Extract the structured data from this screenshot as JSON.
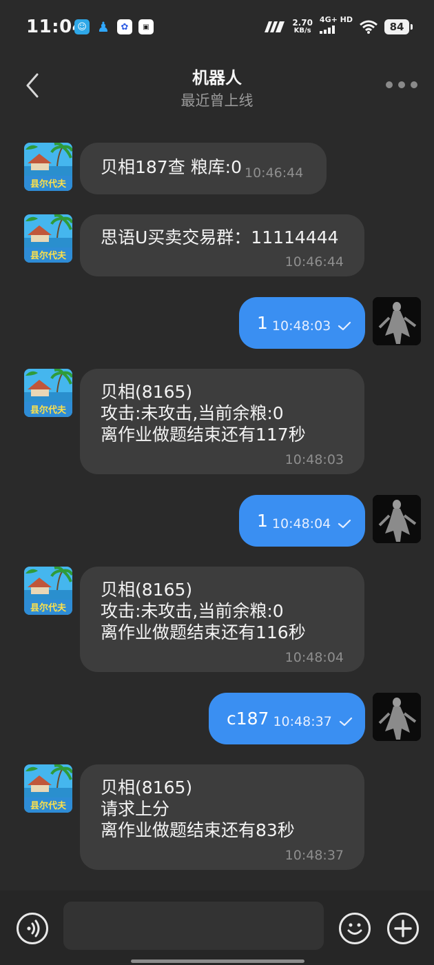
{
  "status_bar": {
    "time": "11:04",
    "net_speed_value": "2.70",
    "net_speed_unit": "KB/s",
    "network_label": "4G+ HD",
    "battery": "84",
    "icons": [
      "chat-app-icon",
      "qq-icon",
      "baidu-icon",
      "notification-badge-icon",
      "signal-strength-icon",
      "wifi-icon",
      "battery-icon"
    ]
  },
  "header": {
    "title": "机器人",
    "subtitle": "最近曾上线"
  },
  "messages": [
    {
      "side": "in",
      "lines": [
        "贝相187查 粮库:0"
      ],
      "time": "10:46:44"
    },
    {
      "side": "in",
      "lines": [
        "思语U买卖交易群：11114444"
      ],
      "time": "10:46:44"
    },
    {
      "side": "out",
      "text": "1",
      "time": "10:48:03"
    },
    {
      "side": "in",
      "lines": [
        "贝相(8165)",
        "攻击:未攻击,当前余粮:0",
        "离作业做题结束还有117秒"
      ],
      "time": "10:48:03"
    },
    {
      "side": "out",
      "text": "1",
      "time": "10:48:04"
    },
    {
      "side": "in",
      "lines": [
        "贝相(8165)",
        "攻击:未攻击,当前余粮:0",
        "离作业做题结束还有116秒"
      ],
      "time": "10:48:04"
    },
    {
      "side": "out",
      "text": "c187",
      "time": "10:48:37"
    },
    {
      "side": "in",
      "lines": [
        "贝相(8165)",
        "请求上分",
        "离作业做题结束还有83秒"
      ],
      "time": "10:48:37"
    }
  ],
  "bot_avatar_text": "县尔代夫",
  "input": {
    "placeholder": ""
  },
  "colors": {
    "background": "#2a2a2a",
    "bubble_in": "#3d3d3d",
    "bubble_out": "#3a8ff2",
    "text": "#f3f3f3",
    "timestamp": "#8e8e8e"
  }
}
